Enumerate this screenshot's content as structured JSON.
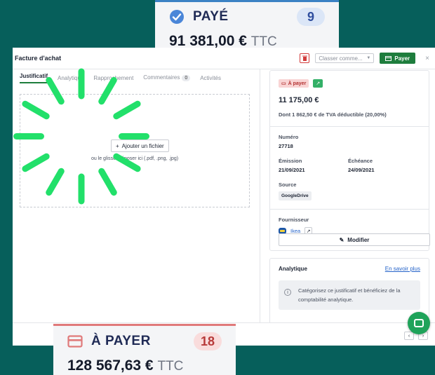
{
  "paid_card": {
    "status": "PAYÉ",
    "count": "9",
    "amount": "91 381,00 €",
    "suffix": "TTC",
    "accent": "#3b82c4"
  },
  "topay_card": {
    "status": "À PAYER",
    "count": "18",
    "amount": "128 567,63 €",
    "suffix": "TTC",
    "accent": "#e07a7a"
  },
  "panel": {
    "title": "Facture d'achat",
    "classer_placeholder": "Classer comme...",
    "pay_label": "Payer",
    "close_label": "×",
    "tabs": [
      {
        "label": "Justificatif"
      },
      {
        "label": "Analytique"
      },
      {
        "label": "Rapprochement"
      },
      {
        "label": "Commentaires",
        "badge": "0"
      },
      {
        "label": "Activités"
      }
    ],
    "add_file_label": "Ajouter un fichier",
    "drop_hint": "ou le glisser/déposer ici (.pdf, .png, .jpg)"
  },
  "invoice": {
    "status_chip": "À payer",
    "amount": "11 175,00 €",
    "vat": "Dont 1 862,50 € de TVA déductible (20,00%)",
    "number_label": "Numéro",
    "number": "27718",
    "issue_label": "Émission",
    "issue_date": "21/09/2021",
    "due_label": "Échéance",
    "due_date": "24/09/2021",
    "source_label": "Source",
    "source": "GoogleDrive",
    "supplier_label": "Fournisseur",
    "supplier": "Ikea",
    "modify_label": "Modifier"
  },
  "analytics": {
    "title": "Analytique",
    "link": "En savoir plus",
    "hint": "Catégorisez ce justificatif et bénéficiez de la comptabilité analytique."
  },
  "colors": {
    "background": "#065f5b",
    "primary_green": "#1e7d3d",
    "spinner": "#22e06a"
  }
}
